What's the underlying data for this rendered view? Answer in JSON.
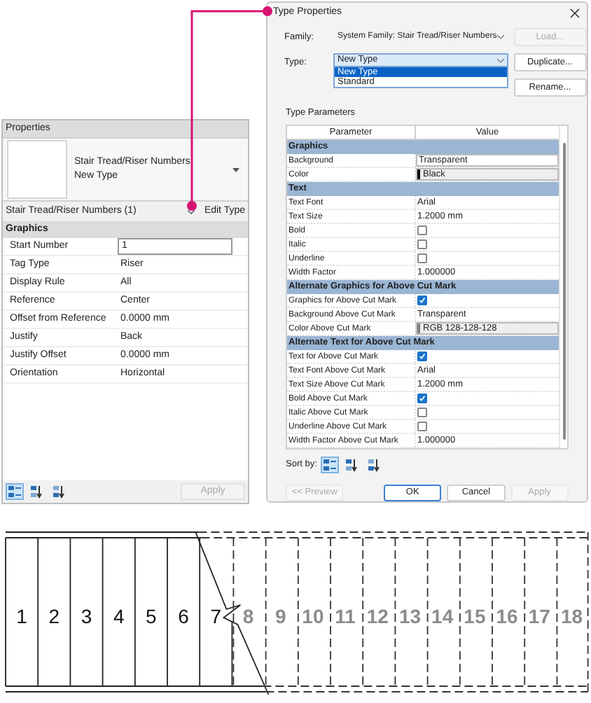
{
  "properties_panel": {
    "title": "Properties",
    "type_name": "Stair Tread/Riser Numbers",
    "type_subname": "New Type",
    "instance_selector": "Stair Tread/Riser Numbers (1)",
    "edit_type_button": "Edit Type",
    "groups": [
      {
        "name": "Graphics",
        "rows": [
          {
            "label": "Start Number",
            "value": "1",
            "kind": "input"
          },
          {
            "label": "Tag Type",
            "value": "Riser",
            "kind": "text"
          },
          {
            "label": "Display Rule",
            "value": "All",
            "kind": "text"
          },
          {
            "label": "Reference",
            "value": "Center",
            "kind": "text"
          },
          {
            "label": "Offset from Reference",
            "value": "0.0000 mm",
            "kind": "text"
          },
          {
            "label": "Justify",
            "value": "Back",
            "kind": "text"
          },
          {
            "label": "Justify Offset",
            "value": "0.0000 mm",
            "kind": "text"
          },
          {
            "label": "Orientation",
            "value": "Horizontal",
            "kind": "text"
          }
        ]
      }
    ],
    "sort_buttons": [
      {
        "kind": "category",
        "selected": true
      },
      {
        "kind": "ascending",
        "selected": false
      },
      {
        "kind": "descending",
        "selected": false
      }
    ],
    "apply_button": {
      "label": "Apply",
      "disabled": true
    }
  },
  "type_properties_dialog": {
    "title": "Type Properties",
    "family_label": "Family:",
    "family_value": "System Family: Stair Tread/Riser Numbers",
    "type_label": "Type:",
    "type_value": "New Type",
    "type_options": [
      {
        "label": "New Type",
        "selected": true
      },
      {
        "label": "Standard",
        "selected": false
      }
    ],
    "side_buttons": [
      {
        "label": "Load...",
        "disabled": true
      },
      {
        "label": "Duplicate...",
        "disabled": false
      },
      {
        "label": "Rename...",
        "disabled": false
      }
    ],
    "section_label": "Type Parameters",
    "columns": [
      "Parameter",
      "Value"
    ],
    "rows": [
      {
        "kind": "header",
        "label": "Graphics"
      },
      {
        "kind": "field",
        "label": "Background",
        "value": "Transparent"
      },
      {
        "kind": "color",
        "label": "Color",
        "value": "Black",
        "color": "#000000"
      },
      {
        "kind": "header",
        "label": "Text"
      },
      {
        "kind": "text",
        "label": "Text Font",
        "value": "Arial"
      },
      {
        "kind": "text",
        "label": "Text Size",
        "value": "1.2000 mm"
      },
      {
        "kind": "checkbox",
        "label": "Bold",
        "checked": false
      },
      {
        "kind": "checkbox",
        "label": "Italic",
        "checked": false
      },
      {
        "kind": "checkbox",
        "label": "Underline",
        "checked": false
      },
      {
        "kind": "text",
        "label": "Width Factor",
        "value": "1.000000"
      },
      {
        "kind": "header",
        "label": "Alternate Graphics for Above Cut Mark"
      },
      {
        "kind": "checkbox",
        "label": "Graphics for Above Cut Mark",
        "checked": true
      },
      {
        "kind": "text",
        "label": "Background Above Cut Mark",
        "value": "Transparent"
      },
      {
        "kind": "color",
        "label": "Color Above Cut Mark",
        "value": "RGB 128-128-128",
        "color": "#808080"
      },
      {
        "kind": "header",
        "label": "Alternate Text for Above Cut Mark"
      },
      {
        "kind": "checkbox",
        "label": "Text for Above Cut Mark",
        "checked": true
      },
      {
        "kind": "text",
        "label": "Text Font Above Cut Mark",
        "value": "Arial"
      },
      {
        "kind": "text",
        "label": "Text Size Above Cut Mark",
        "value": "1.2000 mm"
      },
      {
        "kind": "checkbox",
        "label": "Bold Above Cut Mark",
        "checked": true
      },
      {
        "kind": "checkbox",
        "label": "Italic Above Cut Mark",
        "checked": false
      },
      {
        "kind": "checkbox",
        "label": "Underline Above Cut Mark",
        "checked": false
      },
      {
        "kind": "text",
        "label": "Width Factor Above Cut Mark",
        "value": "1.000000"
      }
    ],
    "sort_label": "Sort by:",
    "sort_buttons": [
      {
        "kind": "category",
        "selected": true
      },
      {
        "kind": "ascending",
        "selected": false
      },
      {
        "kind": "descending",
        "selected": false
      }
    ],
    "footer_buttons": [
      {
        "label": "<< Preview",
        "disabled": true,
        "default": false
      },
      {
        "label": "OK",
        "disabled": false,
        "default": true
      },
      {
        "label": "Cancel",
        "disabled": false,
        "default": false
      },
      {
        "label": "Apply",
        "disabled": true,
        "default": false
      }
    ]
  },
  "stair_plan": {
    "treads": [
      {
        "number": "1",
        "above_cut": false
      },
      {
        "number": "2",
        "above_cut": false
      },
      {
        "number": "3",
        "above_cut": false
      },
      {
        "number": "4",
        "above_cut": false
      },
      {
        "number": "5",
        "above_cut": false
      },
      {
        "number": "6",
        "above_cut": false
      },
      {
        "number": "7",
        "above_cut": false
      },
      {
        "number": "8",
        "above_cut": true
      },
      {
        "number": "9",
        "above_cut": true
      },
      {
        "number": "10",
        "above_cut": true
      },
      {
        "number": "11",
        "above_cut": true
      },
      {
        "number": "12",
        "above_cut": true
      },
      {
        "number": "13",
        "above_cut": true
      },
      {
        "number": "14",
        "above_cut": true
      },
      {
        "number": "15",
        "above_cut": true
      },
      {
        "number": "16",
        "above_cut": true
      },
      {
        "number": "17",
        "above_cut": true
      },
      {
        "number": "18",
        "above_cut": true
      }
    ]
  }
}
